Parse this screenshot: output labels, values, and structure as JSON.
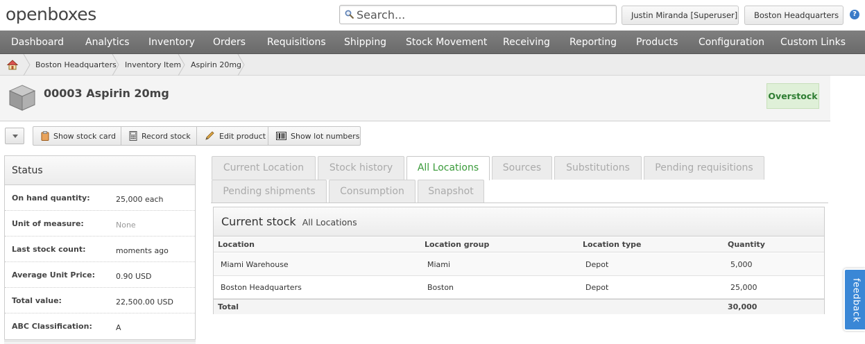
{
  "app": {
    "logo_text": "openboxes"
  },
  "header": {
    "search_placeholder": "Search...",
    "user_label": "Justin Miranda [Superuser]",
    "location_label": "Boston Headquarters",
    "help_glyph": "?"
  },
  "nav": {
    "items": [
      "Dashboard",
      "Analytics",
      "Inventory",
      "Orders",
      "Requisitions",
      "Shipping",
      "Stock Movement",
      "Receiving",
      "Reporting",
      "Products",
      "Configuration",
      "Custom Links"
    ]
  },
  "breadcrumb": {
    "items": [
      "Boston Headquarters",
      "Inventory Item",
      "Aspirin 20mg"
    ]
  },
  "product": {
    "title": "00003 Aspirin 20mg",
    "status": "Overstock",
    "status_color": "#2e7d32"
  },
  "actions": {
    "show_stock_card": "Show stock card",
    "record_stock": "Record stock",
    "edit_product": "Edit product",
    "show_lot_numbers": "Show lot numbers"
  },
  "status_panel": {
    "title": "Status",
    "rows": [
      {
        "label": "On hand quantity:",
        "value": "25,000 each"
      },
      {
        "label": "Unit of measure:",
        "value": "None"
      },
      {
        "label": "Last stock count:",
        "value": "moments ago"
      },
      {
        "label": "Average Unit Price:",
        "value": "0.90 USD"
      },
      {
        "label": "Total value:",
        "value": "22,500.00 USD"
      },
      {
        "label": "ABC Classification:",
        "value": "A"
      }
    ]
  },
  "tabs": {
    "items": [
      "Current Location",
      "Stock history",
      "All Locations",
      "Sources",
      "Substitutions",
      "Pending requisitions",
      "Pending shipments",
      "Consumption",
      "Snapshot"
    ],
    "active": "All Locations",
    "active_color": "#3a9b3a"
  },
  "current_stock": {
    "title": "Current stock",
    "subtitle": "All Locations",
    "columns": [
      "Location",
      "Location group",
      "Location type",
      "Quantity"
    ],
    "rows": [
      {
        "location": "Miami Warehouse",
        "group": "Miami",
        "type": "Depot",
        "quantity": "5,000"
      },
      {
        "location": "Boston Headquarters",
        "group": "Boston",
        "type": "Depot",
        "quantity": "25,000"
      }
    ],
    "total_label": "Total",
    "total_value": "30,000"
  },
  "feedback": {
    "label": "feedback"
  }
}
